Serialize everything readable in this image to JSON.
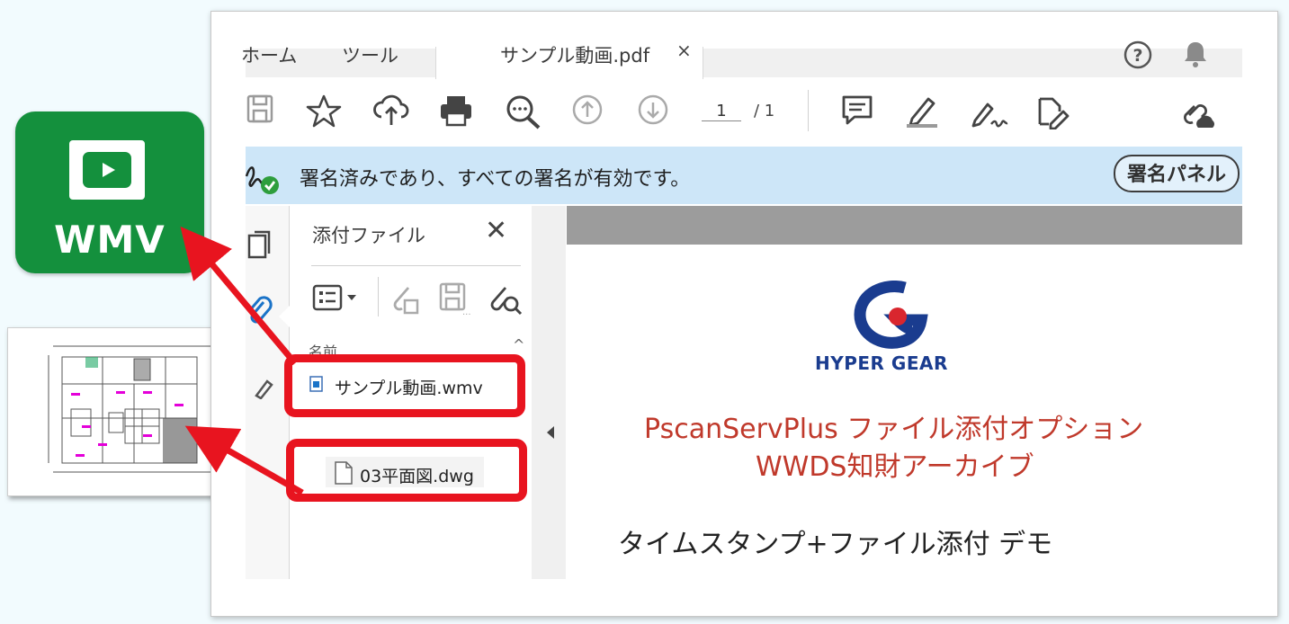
{
  "illustrations": {
    "video_tile_label": "WMV"
  },
  "window": {
    "tabs": [
      {
        "label": "ホーム"
      },
      {
        "label": "ツール"
      },
      {
        "label": "サンプル動画.pdf",
        "active": true
      }
    ],
    "tab_close": "×",
    "help_icon": "question-circle-icon",
    "notification_icon": "bell-icon"
  },
  "toolbar": {
    "icons": [
      "save-icon",
      "star-icon",
      "cloud-upload-icon",
      "print-icon",
      "zoom-icon",
      "page-up-icon",
      "page-down-icon",
      "comment-icon",
      "highlight-pen-icon",
      "sign-icon",
      "edit-pdf-icon",
      "share-link-icon"
    ],
    "page_current": "1",
    "page_total": "/ 1"
  },
  "signature_bar": {
    "message": "署名済みであり、すべての署名が有効です。",
    "panel_button": "署名パネル",
    "accent_color": "#cde6f8"
  },
  "attachments_panel": {
    "title": "添付ファイル",
    "close": "✕",
    "column_header": "名前",
    "files": [
      {
        "name": "サンプル動画.wmv",
        "icon": "video-file-icon"
      },
      {
        "name": "03平面図.dwg",
        "icon": "document-file-icon"
      }
    ]
  },
  "document": {
    "brand": "HYPER GEAR",
    "title_line1": "PscanServPlus ファイル添付オプション",
    "title_line2": "WWDS知財アーカイブ",
    "subtitle": "タイムスタンプ+ファイル添付 デモ",
    "title_color": "#c0392b",
    "brand_color": "#1a3c8f"
  },
  "annotations": {
    "highlight_color": "#e8141f"
  }
}
